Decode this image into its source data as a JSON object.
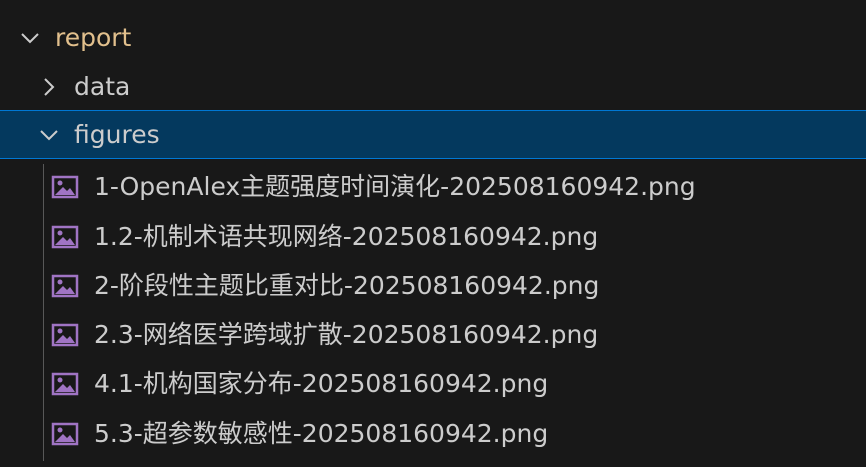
{
  "explorer": {
    "root_folder": {
      "label": "report",
      "expanded": true
    },
    "subfolders": [
      {
        "label": "data",
        "expanded": false
      },
      {
        "label": "figures",
        "expanded": true,
        "selected": true
      }
    ],
    "files": [
      {
        "name": "1-OpenAlex主题强度时间演化-202508160942.png",
        "icon": "image-file-icon"
      },
      {
        "name": "1.2-机制术语共现网络-202508160942.png",
        "icon": "image-file-icon"
      },
      {
        "name": "2-阶段性主题比重对比-202508160942.png",
        "icon": "image-file-icon"
      },
      {
        "name": "2.3-网络医学跨域扩散-202508160942.png",
        "icon": "image-file-icon"
      },
      {
        "name": "4.1-机构国家分布-202508160942.png",
        "icon": "image-file-icon"
      },
      {
        "name": "5.3-超参数敏感性-202508160942.png",
        "icon": "image-file-icon"
      }
    ]
  },
  "colors": {
    "background": "#181818",
    "selection_background": "#04395e",
    "selection_border": "#0078d4",
    "root_folder_text": "#e2c08d",
    "text": "#cccccc",
    "image_icon": "#a074c4"
  }
}
